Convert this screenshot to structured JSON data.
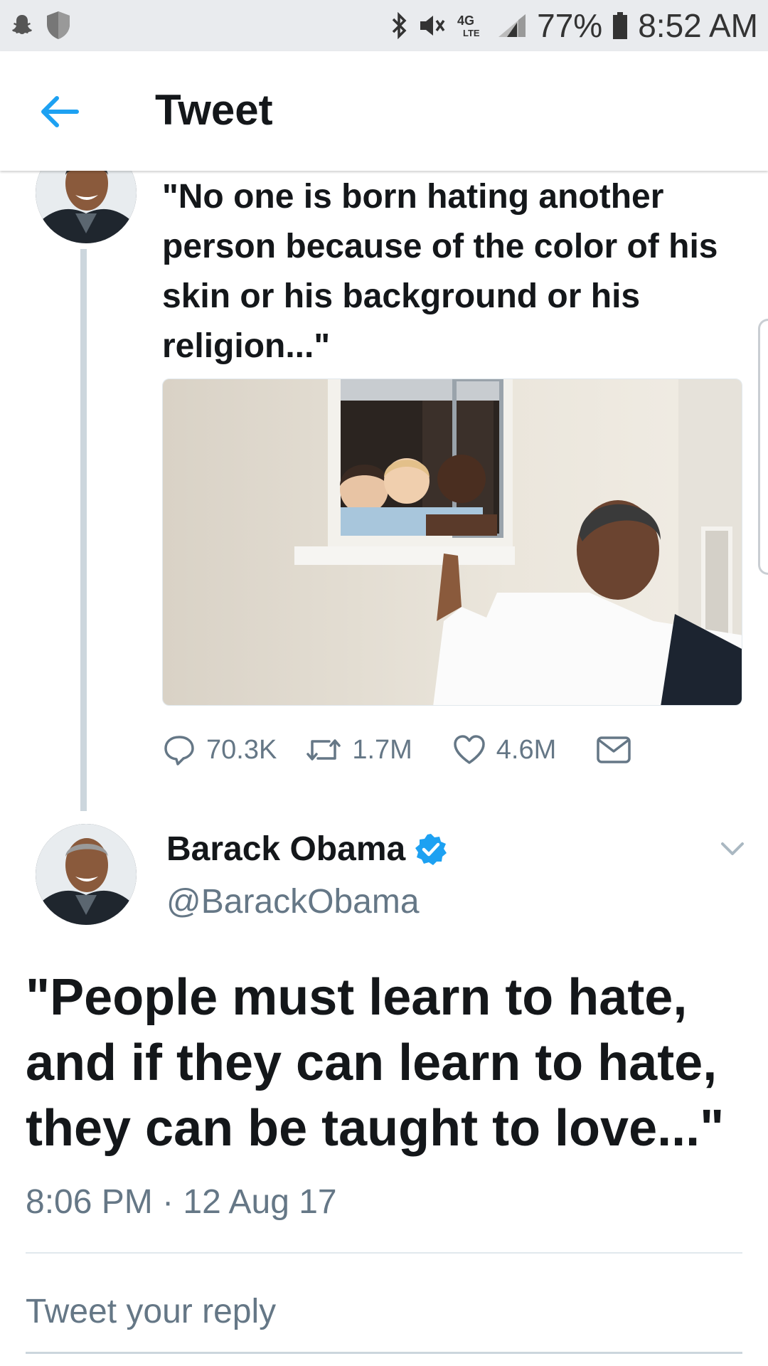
{
  "status_bar": {
    "battery": "77%",
    "time": "8:52 AM",
    "network": "4G LTE"
  },
  "header": {
    "title": "Tweet",
    "back_icon": "arrow-left-icon"
  },
  "previous_tweet": {
    "text": "\"No one is born hating another person because of the color of his skin or his background or his religion...\"",
    "stats": {
      "replies": "70.3K",
      "retweets": "1.7M",
      "likes": "4.6M"
    }
  },
  "main_tweet": {
    "display_name": "Barack Obama",
    "handle": "@BarackObama",
    "verified": true,
    "text": "\"People must learn to hate, and if they can learn to hate, they can be taught to love...\"",
    "timestamp": "8:06 PM · 12 Aug 17"
  },
  "reply": {
    "placeholder": "Tweet your reply"
  },
  "colors": {
    "accent": "#1da1f2",
    "text": "#14171a",
    "secondary": "#657786",
    "status_bar_bg": "#e9ebee"
  }
}
